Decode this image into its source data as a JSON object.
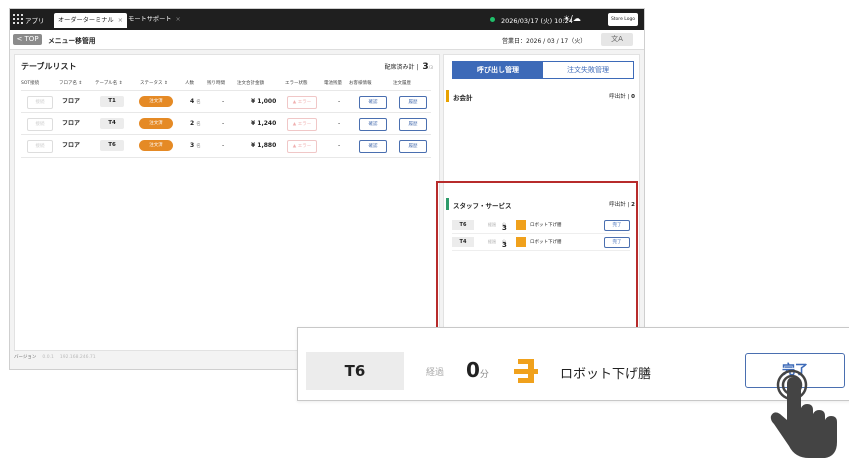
{
  "topbar": {
    "app_name": "アプリ",
    "tabs": [
      {
        "label": "オーダーターミナル",
        "close": "×"
      },
      {
        "label": "リモートサポート",
        "close": "×"
      }
    ],
    "datetime": "2026/03/17 (火) 10:24",
    "weather": "☀/☁",
    "logo": "Store Logo"
  },
  "subbar": {
    "back_label": "< TOP",
    "title": "メニュー移管用",
    "business_day": "営業日：2026 / 03 / 17（火）",
    "lang_icon": "文A"
  },
  "table_list": {
    "title": "テーブルリスト",
    "deployed_label": "配席済み計",
    "deployed_count": "3",
    "deployed_sub": "/3",
    "headers": [
      "SOT接続",
      "フロア名 ⇕",
      "テーブル名 ⇕",
      "ステータス ⇕",
      "人数",
      "残り時間",
      "注文合計金額",
      "エラー状態",
      "電池残量",
      "お客様情報",
      "注文履歴"
    ],
    "rows": [
      {
        "sot": "接続",
        "floor": "フロア",
        "table": "T1",
        "status": "注文済",
        "people": "4",
        "people_unit": "名",
        "remaining": "-",
        "amount": "¥ 1,000",
        "error": "▲ エラー",
        "battery": "-",
        "info_btn": "確認",
        "history_btn": "履歴"
      },
      {
        "sot": "接続",
        "floor": "フロア",
        "table": "T4",
        "status": "注文済",
        "people": "2",
        "people_unit": "名",
        "remaining": "-",
        "amount": "¥ 1,240",
        "error": "▲ エラー",
        "battery": "-",
        "info_btn": "確認",
        "history_btn": "履歴"
      },
      {
        "sot": "接続",
        "floor": "フロア",
        "table": "T6",
        "status": "注文済",
        "people": "3",
        "people_unit": "名",
        "remaining": "-",
        "amount": "¥ 1,880",
        "error": "▲ エラー",
        "battery": "-",
        "info_btn": "確認",
        "history_btn": "履歴"
      }
    ]
  },
  "version": {
    "label": "バージョン",
    "number": "0.0.1",
    "ip": "192.168.246.71"
  },
  "right_panel": {
    "tab_call": "呼び出し管理",
    "tab_failed": "注文失敗管理",
    "billing": {
      "label": "お会計",
      "count_label": "呼出計",
      "count": "0"
    },
    "staff": {
      "label": "スタッフ・サービス",
      "count_label": "呼出計",
      "count": "2"
    },
    "calls": [
      {
        "table": "T6",
        "elapsed": "経過",
        "minutes": "3",
        "unit": "分",
        "service": "ロボット下げ膳",
        "done": "完了"
      },
      {
        "table": "T4",
        "elapsed": "経過",
        "minutes": "3",
        "unit": "分",
        "service": "ロボット下げ膳",
        "done": "完了"
      }
    ]
  },
  "zoom_row": {
    "table": "T6",
    "elapsed": "経過",
    "minutes": "0",
    "unit": "分",
    "service": "ロボット下げ膳",
    "done": "完了"
  },
  "colors": {
    "accent_blue": "#3d6ab8",
    "status_orange": "#e58a25",
    "highlight_red": "#b72b2b",
    "robot_orange": "#f0a11c"
  }
}
